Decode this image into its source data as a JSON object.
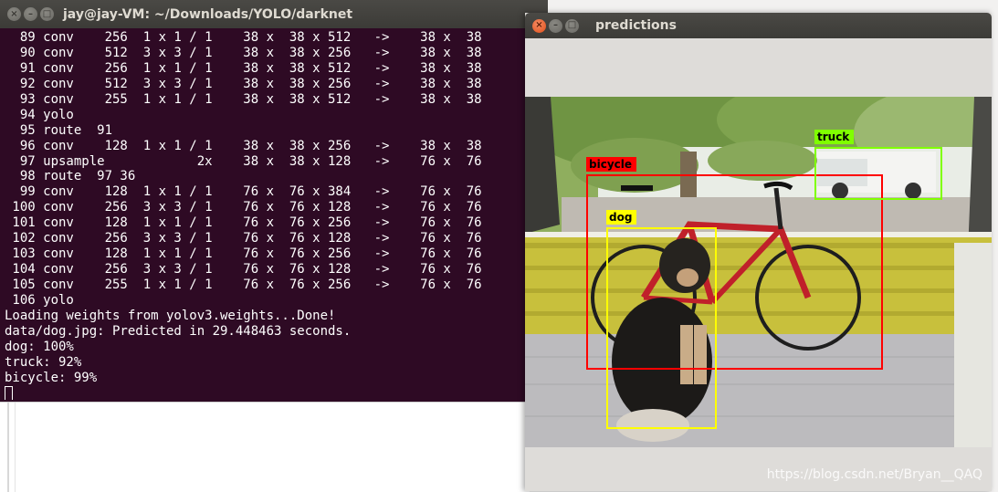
{
  "terminal": {
    "title": "jay@jay-VM: ~/Downloads/YOLO/darknet",
    "lines": [
      "  89 conv    256  1 x 1 / 1    38 x  38 x 512   ->    38 x  38",
      "  90 conv    512  3 x 3 / 1    38 x  38 x 256   ->    38 x  38",
      "  91 conv    256  1 x 1 / 1    38 x  38 x 512   ->    38 x  38",
      "  92 conv    512  3 x 3 / 1    38 x  38 x 256   ->    38 x  38",
      "  93 conv    255  1 x 1 / 1    38 x  38 x 512   ->    38 x  38",
      "  94 yolo",
      "  95 route  91",
      "  96 conv    128  1 x 1 / 1    38 x  38 x 256   ->    38 x  38",
      "  97 upsample            2x    38 x  38 x 128   ->    76 x  76",
      "  98 route  97 36",
      "  99 conv    128  1 x 1 / 1    76 x  76 x 384   ->    76 x  76",
      " 100 conv    256  3 x 3 / 1    76 x  76 x 128   ->    76 x  76",
      " 101 conv    128  1 x 1 / 1    76 x  76 x 256   ->    76 x  76",
      " 102 conv    256  3 x 3 / 1    76 x  76 x 128   ->    76 x  76",
      " 103 conv    128  1 x 1 / 1    76 x  76 x 256   ->    76 x  76",
      " 104 conv    256  3 x 3 / 1    76 x  76 x 128   ->    76 x  76",
      " 105 conv    255  1 x 1 / 1    76 x  76 x 256   ->    76 x  76",
      " 106 yolo",
      "Loading weights from yolov3.weights...Done!",
      "data/dog.jpg: Predicted in 29.448463 seconds.",
      "dog: 100%",
      "truck: 92%",
      "bicycle: 99%"
    ],
    "colors": {
      "background": "#2e0a24",
      "text": "#ffffff"
    }
  },
  "predictions": {
    "title": "predictions",
    "detections": [
      {
        "label": "bicycle",
        "color": "#ff0000",
        "text_color": "#000000"
      },
      {
        "label": "truck",
        "color": "#80ff00",
        "text_color": "#000000"
      },
      {
        "label": "dog",
        "color": "#ffff00",
        "text_color": "#000000"
      }
    ]
  },
  "window_buttons": {
    "close": "close-icon",
    "minimize": "minimize-icon",
    "maximize": "maximize-icon"
  },
  "watermark": "https://blog.csdn.net/Bryan__QAQ"
}
